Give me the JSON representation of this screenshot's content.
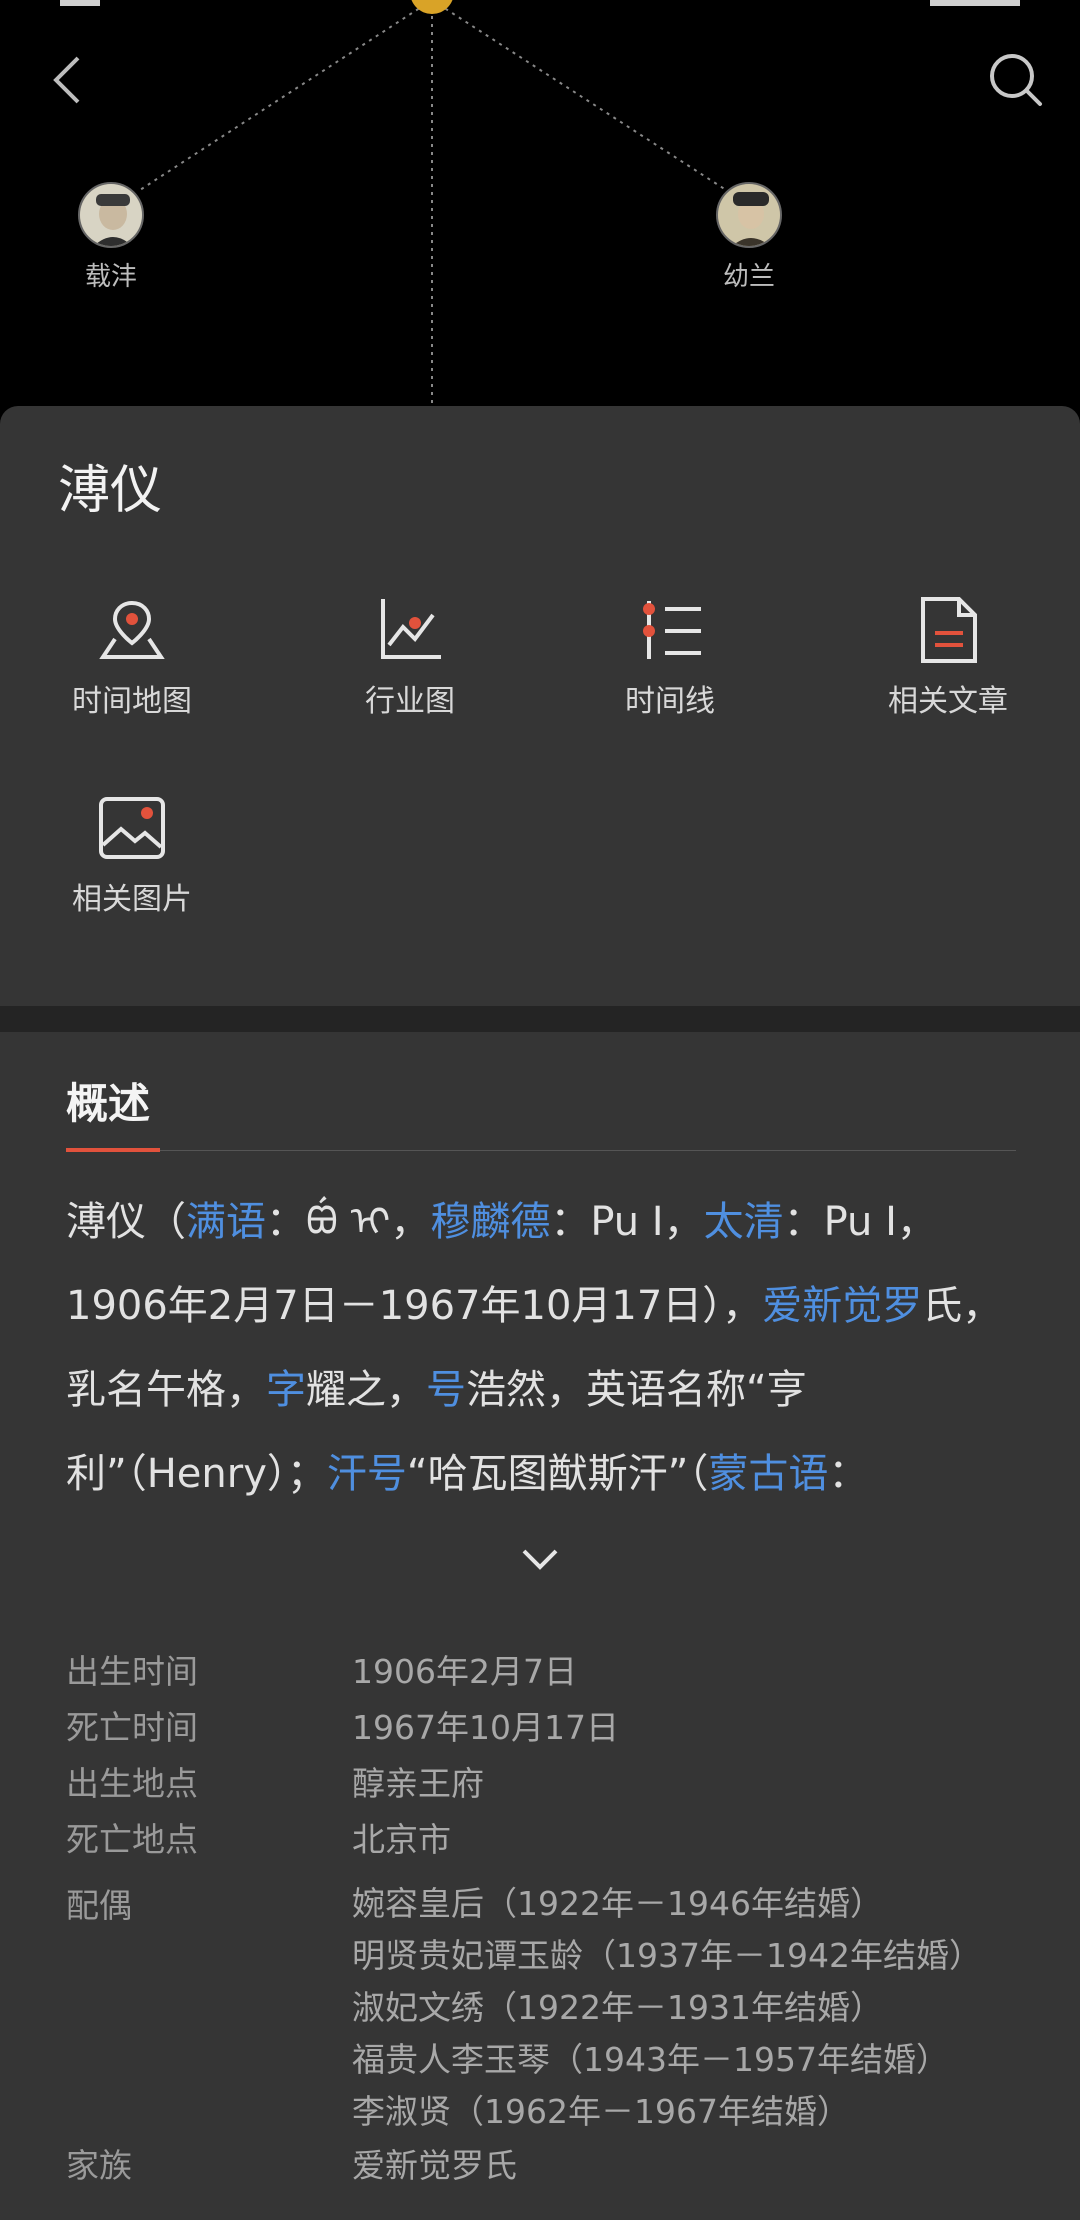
{
  "nav": {
    "back_icon": "chevron-left-icon",
    "search_icon": "search-icon"
  },
  "graph": {
    "relatives": [
      {
        "name": "载沣"
      },
      {
        "name": "幼兰"
      }
    ]
  },
  "sheet": {
    "title": "溥仪",
    "features": [
      {
        "label": "时间地图",
        "icon": "map-pin-icon"
      },
      {
        "label": "行业图",
        "icon": "line-chart-icon"
      },
      {
        "label": "时间线",
        "icon": "timeline-icon"
      },
      {
        "label": "相关文章",
        "icon": "document-icon"
      },
      {
        "label": "相关图片",
        "icon": "image-icon"
      }
    ],
    "accent_color": "#e2523c"
  },
  "overview": {
    "tab_label": "概述",
    "intro": {
      "p1": "溥仪（",
      "l1": "满语",
      "p2": "：ᡦᡠ ᡳ，",
      "l2": "穆麟德",
      "p3": "：Pu I，",
      "l3": "太清",
      "p4": "：Pu I，1906年2月7日－1967年10月17日），",
      "l4": "爱新觉罗",
      "p5": "氏，乳名午格，",
      "l5": "字",
      "p6": "耀之，",
      "l6": "号",
      "p7": "浩然，英语名称“亨利”（Henry）；",
      "l7": "汗号",
      "p8": "“哈瓦图猷斯汗”（",
      "l8": "蒙古语",
      "p9": "："
    },
    "link_color": "#4f8fe0",
    "expand_icon": "chevron-down-icon",
    "facts": [
      {
        "key": "出生时间",
        "value": "1906年2月7日"
      },
      {
        "key": "死亡时间",
        "value": "1967年10月17日"
      },
      {
        "key": "出生地点",
        "value": "醇亲王府"
      },
      {
        "key": "死亡地点",
        "value": "北京市"
      }
    ],
    "spouse": {
      "key": "配偶",
      "values": [
        "婉容皇后（1922年－1946年结婚）",
        "明贤贵妃谭玉龄（1937年－1942年结婚）",
        "淑妃文绣（1922年－1931年结婚）",
        "福贵人李玉琴（1943年－1957年结婚）",
        "李淑贤（1962年－1967年结婚）"
      ]
    },
    "partial_row": {
      "key": "家族",
      "value": "爱新觉罗氏"
    }
  }
}
